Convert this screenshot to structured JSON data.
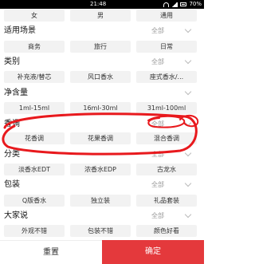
{
  "status_bar": {
    "time": "21:48",
    "battery": "70%",
    "left_text": ""
  },
  "rows": {
    "gender": [
      "女",
      "男",
      "通用"
    ]
  },
  "sections": {
    "scene": {
      "title": "适用场景",
      "all": "全部",
      "options": [
        "商务",
        "旅行",
        "日常"
      ]
    },
    "category": {
      "title": "类别",
      "all": "全部",
      "options": [
        "补充液/替芯",
        "风口香水",
        "座式香水/..."
      ]
    },
    "volume": {
      "title": "净含量",
      "all": "",
      "options": [
        "1ml-15ml",
        "16ml-30ml",
        "31ml-100ml"
      ]
    },
    "fragrance": {
      "title": "香调",
      "all": "全部",
      "options": [
        "花香调",
        "花果香调",
        "混合香调"
      ]
    },
    "type": {
      "title": "分类",
      "all": "全部",
      "options": [
        "淡香水EDT",
        "浓香水EDP",
        "古龙水"
      ]
    },
    "package": {
      "title": "包装",
      "all": "全部",
      "options": [
        "Q版香水",
        "独立装",
        "礼品套装"
      ]
    },
    "opinion": {
      "title": "大家说",
      "all": "全部",
      "options": [
        "外观不错",
        "包装不错",
        "颜色好看"
      ]
    }
  },
  "footer": {
    "reset_label": "重置",
    "confirm_label": "确定"
  },
  "colors": {
    "accent": "#e4393c",
    "annotation": "#e8191d",
    "chip_bg": "#f2f2f2"
  },
  "icons": [
    "wifi-icon",
    "signal-icon",
    "battery-icon",
    "chevron-down-icon"
  ]
}
